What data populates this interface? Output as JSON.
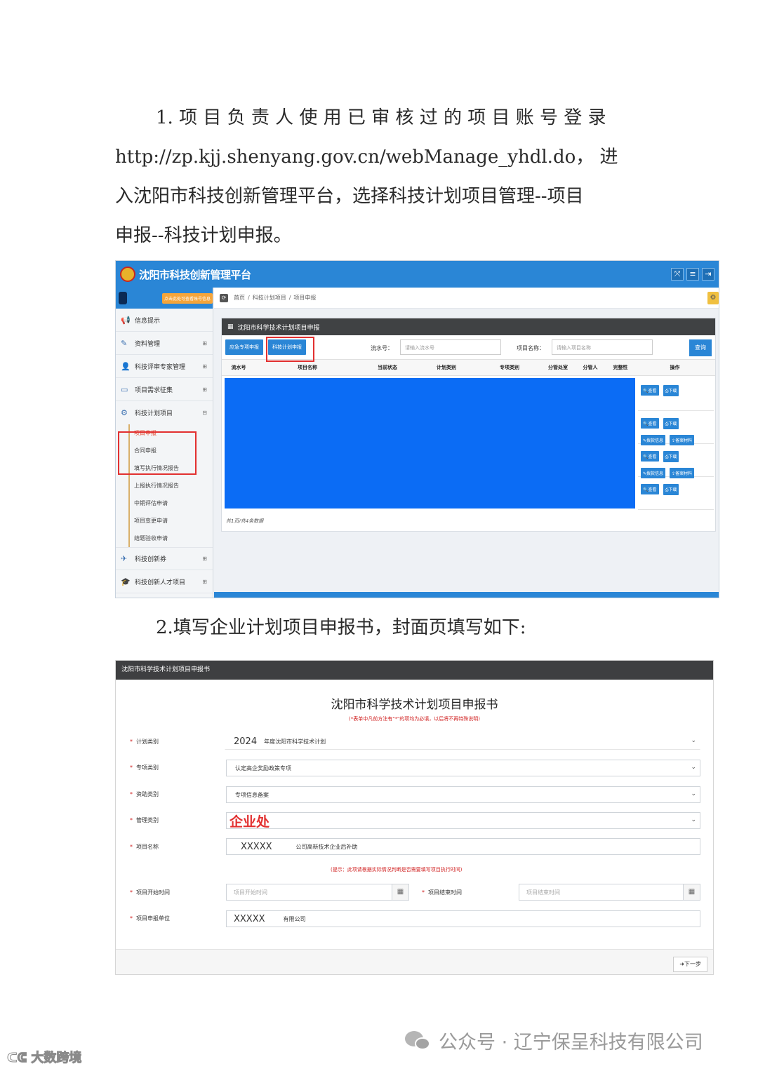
{
  "step1": {
    "line1": "1. 项 目 负 责 人 使 用 已 审 核 过 的 项 目 账 号 登 录",
    "line2": "http://zp.kjj.shenyang.gov.cn/webManage_yhdl.do， 进",
    "line3": "入沈阳市科技创新管理平台，选择科技计划项目管理--项目",
    "line4": "申报--科技计划申报。"
  },
  "step2": {
    "text": "2.填写企业计划项目申报书，封面页填写如下:"
  },
  "shot1": {
    "app_title": "沈阳市科技创新管理平台",
    "top_icons": [
      "⤧",
      "≡",
      "⇥"
    ],
    "user_tip": "点击此处可查看账号信息",
    "breadcrumb": [
      "首页",
      "科技计划项目",
      "项目申报"
    ],
    "sidebar": {
      "items": [
        {
          "icon": "📢",
          "label": "信息提示"
        },
        {
          "icon": "✎",
          "label": "资料管理"
        },
        {
          "icon": "👤",
          "label": "科技评审专家管理"
        },
        {
          "icon": "▭",
          "label": "项目需求征集"
        },
        {
          "icon": "⚙",
          "label": "科技计划项目"
        }
      ],
      "sub_items": [
        "项目申报",
        "合同申报",
        "填写执行情况报告",
        "上报执行情况报告",
        "中期评估申请",
        "项目变更申请",
        "结题验收申请"
      ],
      "bottom_items": [
        {
          "icon": "✈",
          "label": "科技创新券"
        },
        {
          "icon": "🎓",
          "label": "科技创新人才项目"
        }
      ]
    },
    "panel_title": "沈阳市科学技术计划项目申报",
    "toolbar": {
      "btn_emergency": "应急专项申报",
      "btn_plan": "科技计划申报",
      "serial_label": "流水号：",
      "serial_placeholder": "请输入流水号",
      "name_label": "项目名称：",
      "name_placeholder": "请输入项目名称",
      "query": "查询"
    },
    "columns": [
      "流水号",
      "项目名称",
      "当前状态",
      "计划类别",
      "专项类别",
      "分管处室",
      "分管人",
      "完整性",
      "操作"
    ],
    "ops": {
      "view": "查看",
      "download": "下载",
      "appropriation": "拨款信息",
      "filing": "备案材料"
    },
    "total": "共1页/共4条数据"
  },
  "shot2": {
    "header": "沈阳市科学技术计划项目申报书",
    "title": "沈阳市科学技术计划项目申报书",
    "note": "(*表单中凡前方注有\"*\"的项均为必填，以后将不再特殊说明)",
    "fields": {
      "plan_type": {
        "label": "计划类别",
        "year": "2024",
        "value": "年度沈阳市科学技术计划"
      },
      "special_type": {
        "label": "专项类别",
        "value": "认定高企奖励政策专项"
      },
      "funding_type": {
        "label": "资助类别",
        "value": "专项信息备案"
      },
      "manage_type": {
        "label": "管理类别",
        "value": "企业处"
      },
      "project_name": {
        "label": "项目名称",
        "prefix": "XXXXX",
        "value": "公司高新技术企业后补助"
      },
      "start_time": {
        "label": "项目开始时间",
        "placeholder": "项目开始时间"
      },
      "end_time": {
        "label": "项目结束时间",
        "placeholder": "项目结束时间"
      },
      "unit": {
        "label": "项目申报单位",
        "prefix": "XXXXX",
        "value": "有限公司"
      }
    },
    "tip": "(提示：此项请根据实际情况判断是否需要填写项目执行时间)",
    "next": "下一步"
  },
  "watermark": {
    "left": "大数跨境",
    "right": "公众号 · 辽宁保呈科技有限公司"
  }
}
